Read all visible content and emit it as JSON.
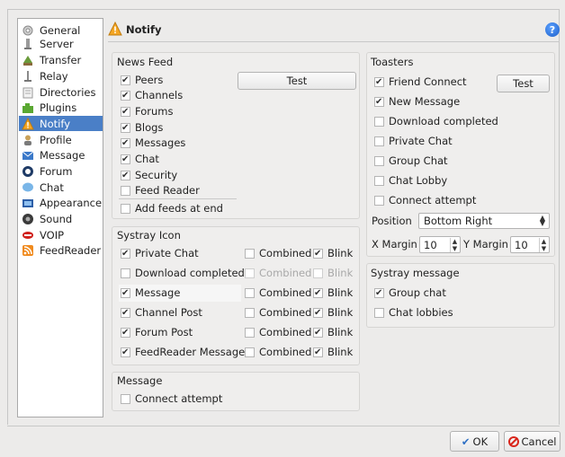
{
  "sidebar": {
    "items": [
      {
        "label": "General",
        "icon": "gear-icon"
      },
      {
        "label": "Server",
        "icon": "server-icon"
      },
      {
        "label": "Transfer",
        "icon": "transfer-icon"
      },
      {
        "label": "Relay",
        "icon": "relay-icon"
      },
      {
        "label": "Directories",
        "icon": "folder-icon"
      },
      {
        "label": "Plugins",
        "icon": "puzzle-icon"
      },
      {
        "label": "Notify",
        "icon": "warning-icon",
        "selected": true
      },
      {
        "label": "Profile",
        "icon": "person-icon"
      },
      {
        "label": "Message",
        "icon": "message-icon"
      },
      {
        "label": "Forum",
        "icon": "forum-icon"
      },
      {
        "label": "Chat",
        "icon": "chat-bubble-icon"
      },
      {
        "label": "Appearance",
        "icon": "appearance-icon"
      },
      {
        "label": "Sound",
        "icon": "speaker-icon"
      },
      {
        "label": "VOIP",
        "icon": "voip-icon"
      },
      {
        "label": "FeedReader",
        "icon": "rss-icon"
      }
    ]
  },
  "header": {
    "title": "Notify"
  },
  "news_feed": {
    "title": "News Feed",
    "test_label": "Test",
    "items": [
      {
        "label": "Peers",
        "checked": true
      },
      {
        "label": "Channels",
        "checked": true
      },
      {
        "label": "Forums",
        "checked": true
      },
      {
        "label": "Blogs",
        "checked": true
      },
      {
        "label": "Messages",
        "checked": true
      },
      {
        "label": "Chat",
        "checked": true
      },
      {
        "label": "Security",
        "checked": true
      },
      {
        "label": "Feed Reader",
        "checked": false
      },
      {
        "label": "Add feeds at end",
        "checked": false
      }
    ]
  },
  "systray_icon": {
    "title": "Systray Icon",
    "combined_label": "Combined",
    "blink_label": "Blink",
    "rows": [
      {
        "label": "Private Chat",
        "checked": true,
        "combined": false,
        "blink": true,
        "disabled": false
      },
      {
        "label": "Download completed",
        "checked": false,
        "combined": false,
        "blink": false,
        "disabled": true
      },
      {
        "label": "Message",
        "checked": true,
        "combined": false,
        "blink": true,
        "disabled": false
      },
      {
        "label": "Channel Post",
        "checked": true,
        "combined": false,
        "blink": true,
        "disabled": false
      },
      {
        "label": "Forum Post",
        "checked": true,
        "combined": false,
        "blink": true,
        "disabled": false
      },
      {
        "label": "FeedReader Message",
        "checked": true,
        "combined": false,
        "blink": true,
        "disabled": false
      }
    ]
  },
  "message_group": {
    "title": "Message",
    "items": [
      {
        "label": "Connect attempt",
        "checked": false
      }
    ]
  },
  "toasters": {
    "title": "Toasters",
    "test_label": "Test",
    "items": [
      {
        "label": "Friend Connect",
        "checked": true
      },
      {
        "label": "New Message",
        "checked": true
      },
      {
        "label": "Download completed",
        "checked": false
      },
      {
        "label": "Private Chat",
        "checked": false
      },
      {
        "label": "Group Chat",
        "checked": false
      },
      {
        "label": "Chat Lobby",
        "checked": false
      },
      {
        "label": "Connect attempt",
        "checked": false
      }
    ],
    "position_label": "Position",
    "position_value": "Bottom Right",
    "x_margin_label": "X Margin",
    "x_margin_value": "10",
    "y_margin_label": "Y Margin",
    "y_margin_value": "10"
  },
  "systray_message": {
    "title": "Systray message",
    "items": [
      {
        "label": "Group chat",
        "checked": true
      },
      {
        "label": "Chat lobbies",
        "checked": false
      }
    ]
  },
  "footer": {
    "ok_label": "OK",
    "cancel_label": "Cancel"
  },
  "colors": {
    "selection": "#4a7fc7",
    "help_icon": "#1d5fc9",
    "cancel_icon": "#d9261c",
    "ok_icon": "#2d6fc4"
  }
}
